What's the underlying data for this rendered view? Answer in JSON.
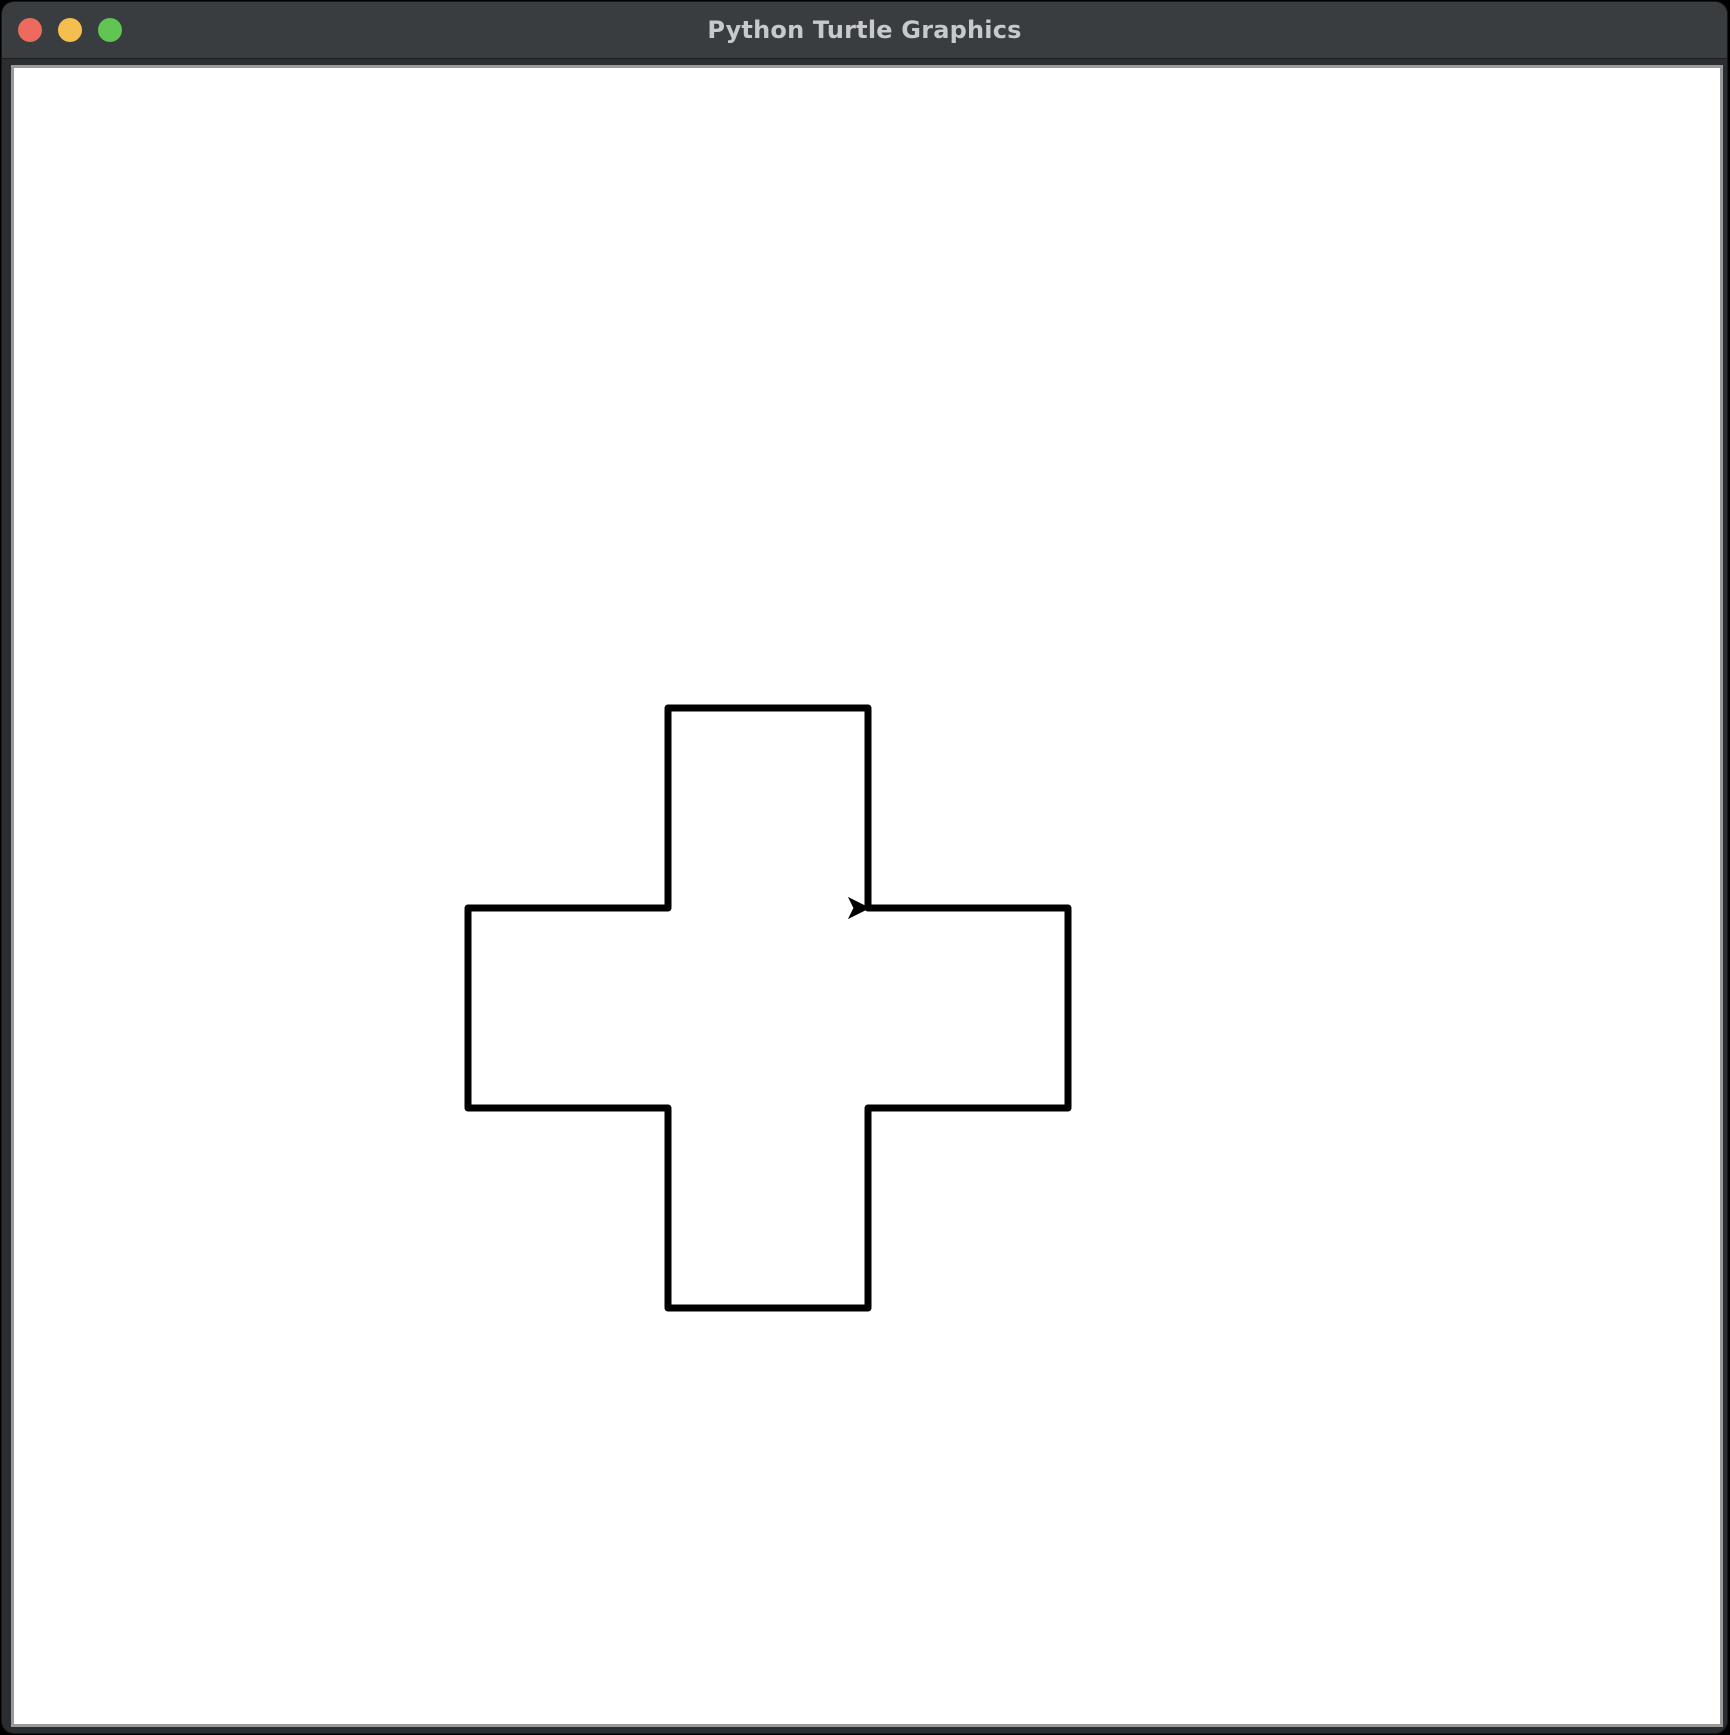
{
  "window": {
    "title": "Python Turtle Graphics"
  },
  "controls": {
    "close": "close",
    "minimize": "minimize",
    "maximize": "zoom"
  },
  "colors": {
    "close": "#ed6a5e",
    "minimize": "#f5bf4f",
    "maximize": "#61c554",
    "canvas_background": "#ffffff",
    "pen": "#000000"
  },
  "drawing": {
    "shape": "cross",
    "turtle_heading": "right"
  }
}
